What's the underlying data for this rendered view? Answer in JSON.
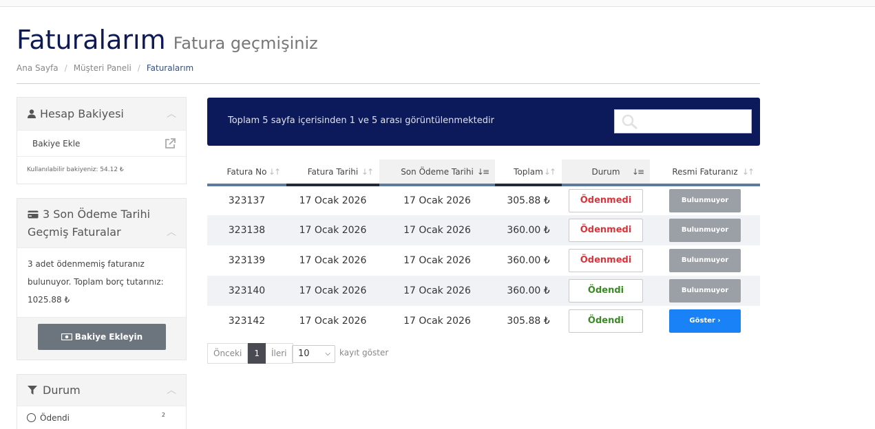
{
  "page": {
    "title": "Faturalarım",
    "subtitle": "Fatura geçmişiniz",
    "breadcrumb": [
      "Ana Sayfa",
      "Müşteri Paneli",
      "Faturalarım"
    ]
  },
  "sidebar": {
    "balance": {
      "title": "Hesap Bakiyesi",
      "add_link": "Bakiye Ekle",
      "available": "Kullanılabilir bakiyeniz: 54.12 ₺"
    },
    "overdue": {
      "title": "3 Son Ödeme Tarihi Geçmiş Faturalar",
      "text": "3 adet ödenmemiş faturanız bulunuyor. Toplam borç tutarınız: 1025.88 ₺",
      "button": "Bakiye Ekleyin"
    },
    "filter": {
      "title": "Durum",
      "option": "Ödendi",
      "count": "2"
    }
  },
  "banner": {
    "info": "Toplam 5 sayfa içerisinden 1 ve 5 arası görüntülenmektedir",
    "search_placeholder": ""
  },
  "table": {
    "headers": [
      "Fatura No",
      "Fatura Tarihi",
      "Son Ödeme Tarihi",
      "Toplam",
      "Durum",
      "Resmi Faturanız"
    ],
    "rows": [
      {
        "no": "323137",
        "date": "17 Ocak 2026",
        "due": "17 Ocak 2026",
        "total": "305.88 ₺",
        "status": "Ödenmedi",
        "official": "Bulunmuyor"
      },
      {
        "no": "323138",
        "date": "17 Ocak 2026",
        "due": "17 Ocak 2026",
        "total": "360.00 ₺",
        "status": "Ödenmedi",
        "official": "Bulunmuyor"
      },
      {
        "no": "323139",
        "date": "17 Ocak 2026",
        "due": "17 Ocak 2026",
        "total": "360.00 ₺",
        "status": "Ödenmedi",
        "official": "Bulunmuyor"
      },
      {
        "no": "323140",
        "date": "17 Ocak 2026",
        "due": "17 Ocak 2026",
        "total": "360.00 ₺",
        "status": "Ödendi",
        "official": "Bulunmuyor"
      },
      {
        "no": "323142",
        "date": "17 Ocak 2026",
        "due": "17 Ocak 2026",
        "total": "305.88 ₺",
        "status": "Ödendi",
        "official": "Göster"
      }
    ]
  },
  "pagination": {
    "prev": "Önceki",
    "current": "1",
    "next": "İleri",
    "page_size": "10",
    "page_size_label": "kayıt göster"
  },
  "colors": {
    "banner": "#0c1a5c",
    "title": "#0f1a52",
    "unpaid": "#d9343b",
    "paid": "#3a8a24",
    "primary": "#1a82f7"
  }
}
